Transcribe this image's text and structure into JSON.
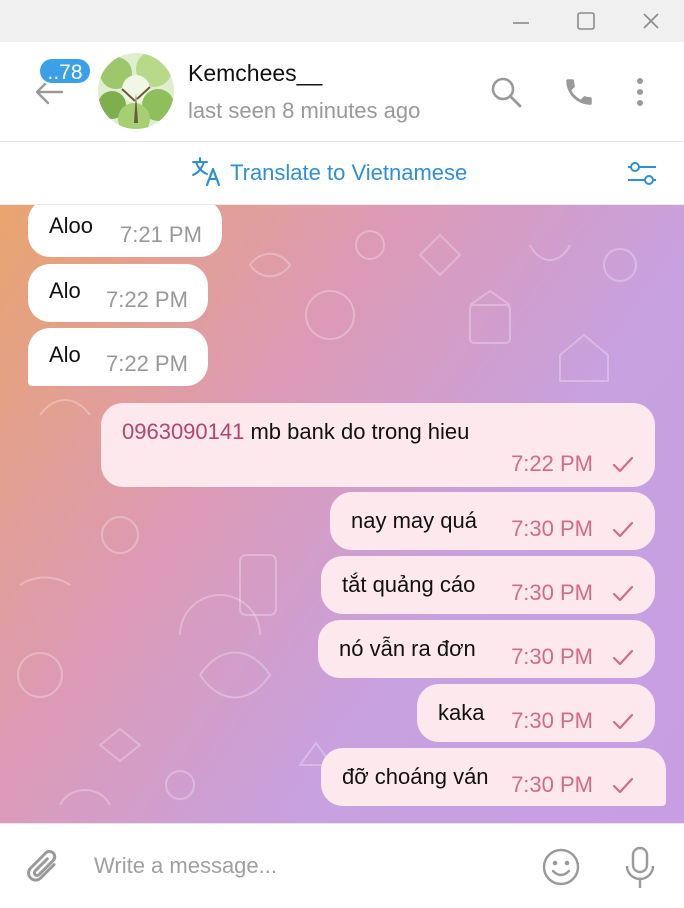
{
  "window": {
    "controls": [
      "minimize-icon",
      "maximize-icon",
      "close-icon"
    ]
  },
  "header": {
    "unread_badge": "..78",
    "contact_name": "Kemchees__",
    "status": "last seen 8 minutes ago",
    "icons": [
      "back-arrow-icon",
      "search-icon",
      "phone-icon",
      "more-vertical-icon"
    ]
  },
  "translate": {
    "label": "Translate to Vietnamese",
    "icon": "translate-icon",
    "settings_icon": "sliders-icon"
  },
  "colors": {
    "accent": "#2f8fd6",
    "badge": "#3aa0e8",
    "outgoing_bubble": "#fde8ee",
    "outgoing_time": "#d26a8c"
  },
  "messages": {
    "incoming": [
      {
        "text": "Aloo",
        "time": "7:21 PM"
      },
      {
        "text": "Alo",
        "time": "7:22 PM"
      },
      {
        "text": "Alo",
        "time": "7:22 PM"
      }
    ],
    "outgoing": [
      {
        "phone": "0963090141",
        "text": " mb bank do trong hieu",
        "time": "7:22 PM"
      },
      {
        "text": "nay may quá",
        "time": "7:30 PM"
      },
      {
        "text": "tắt quảng cáo",
        "time": "7:30 PM"
      },
      {
        "text": "nó vẫn ra đơn",
        "time": "7:30 PM"
      },
      {
        "text": "kaka",
        "time": "7:30 PM"
      },
      {
        "text": "đỡ choáng ván",
        "time": "7:30 PM"
      }
    ]
  },
  "composer": {
    "placeholder": "Write a message...",
    "icons": [
      "paperclip-icon",
      "emoji-icon",
      "microphone-icon"
    ]
  }
}
